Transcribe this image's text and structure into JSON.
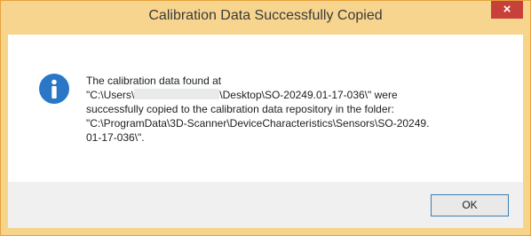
{
  "dialog": {
    "title": "Calibration Data Successfully Copied",
    "close_glyph": "×",
    "icon": "info-icon",
    "message": {
      "line1": "The calibration data found at",
      "path_start": "\"C:\\Users\\",
      "path_end": "\\Desktop\\SO-20249.01-17-036\\\" were",
      "line3": "successfully copied to the calibration data repository in the folder:",
      "line4": "\"C:\\ProgramData\\3D-Scanner\\DeviceCharacteristics\\Sensors\\SO-20249.",
      "line5": "01-17-036\\\"."
    },
    "ok_label": "OK"
  },
  "colors": {
    "title_bar": "#f7d58e",
    "close_button": "#c7413a",
    "info_icon": "#2a77c8",
    "ok_border": "#3c7fb1"
  }
}
